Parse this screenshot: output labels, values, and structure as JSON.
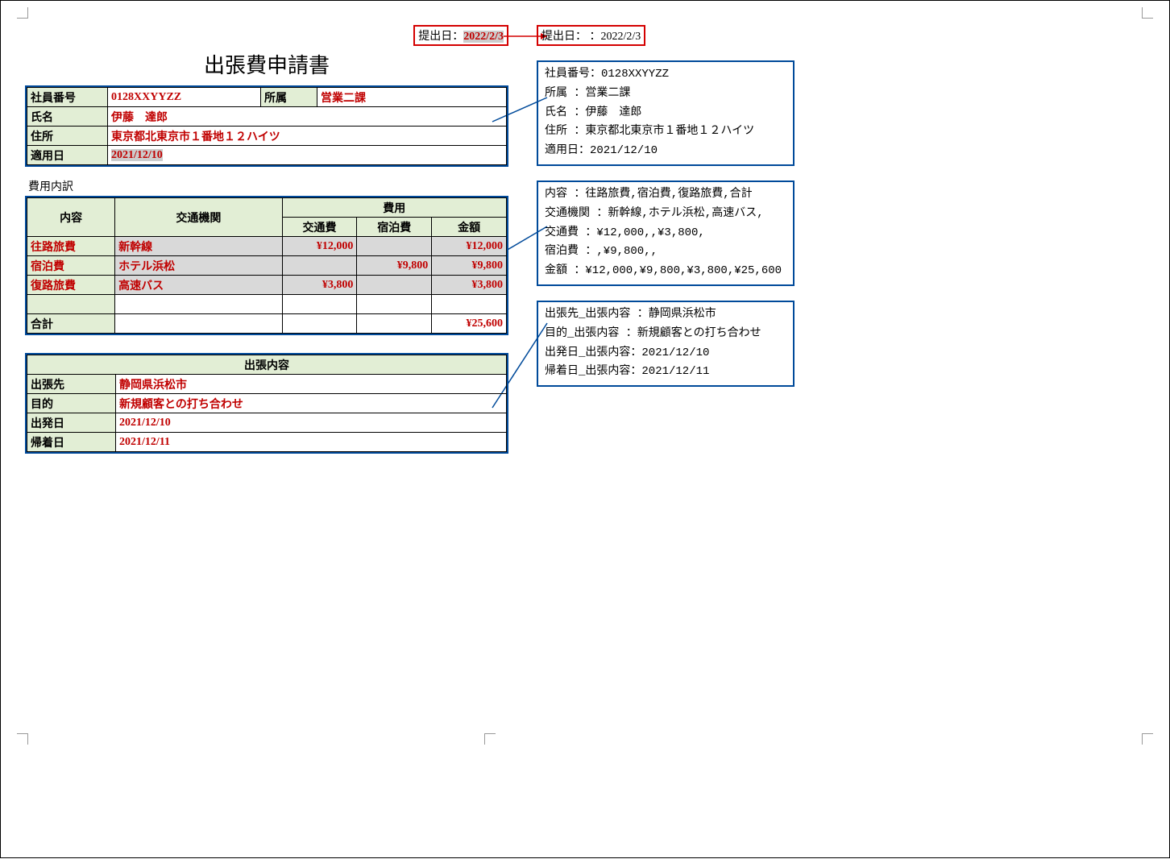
{
  "submit": {
    "label": "提出日：",
    "date": "2022/2/3"
  },
  "submit2": {
    "label": "提出日： ：",
    "date": "2022/2/3"
  },
  "title": "出張費申請書",
  "employee": {
    "id_label": "社員番号",
    "id": "0128XXYYZZ",
    "dept_label": "所属",
    "dept": "営業二課",
    "name_label": "氏名",
    "name": "伊藤　達郎",
    "addr_label": "住所",
    "addr": "東京都北東京市１番地１２ハイツ",
    "apply_label": "適用日",
    "apply": "2021/12/10"
  },
  "expense": {
    "section_label": "費用内訳",
    "headers": {
      "content": "内容",
      "transport": "交通機関",
      "cost": "費用",
      "trans_cost": "交通費",
      "lodge_cost": "宿泊費",
      "amount": "金額"
    },
    "rows": [
      {
        "content": "往路旅費",
        "transport": "新幹線",
        "trans": "¥12,000",
        "lodge": "",
        "amount": "¥12,000",
        "shade": true
      },
      {
        "content": "宿泊費",
        "transport": "ホテル浜松",
        "trans": "",
        "lodge": "¥9,800",
        "amount": "¥9,800",
        "shade": true
      },
      {
        "content": "復路旅費",
        "transport": "高速バス",
        "trans": "¥3,800",
        "lodge": "",
        "amount": "¥3,800",
        "shade": true
      },
      {
        "content": "",
        "transport": "",
        "trans": "",
        "lodge": "",
        "amount": "",
        "shade": false
      }
    ],
    "total_label": "合計",
    "total": "¥25,600"
  },
  "trip": {
    "header": "出張内容",
    "dest_label": "出張先",
    "dest": "静岡県浜松市",
    "purpose_label": "目的",
    "purpose": "新規顧客との打ち合わせ",
    "depart_label": "出発日",
    "depart": "2021/12/10",
    "return_label": "帰着日",
    "return": "2021/12/11"
  },
  "anno1": {
    "l1a": "社員番号：",
    "l1b": "0128XXYYZZ",
    "l2": "所属 ：営業二課",
    "l3": "氏名 ：伊藤　達郎",
    "l4": "住所 ：東京都北東京市１番地１２ハイツ",
    "l5": "適用日：2021/12/10"
  },
  "anno2": {
    "l1": "内容 ：往路旅費,宿泊費,復路旅費,合計",
    "l2": "交通機関 ：新幹線,ホテル浜松,高速バス,",
    "l3": "交通費 ：¥12,000,,¥3,800,",
    "l4": "宿泊費 ：,¥9,800,,",
    "l5": "金額 ：¥12,000,¥9,800,¥3,800,¥25,600"
  },
  "anno3": {
    "l1": "出張先_出張内容 ：静岡県浜松市",
    "l2": "目的_出張内容 ：新規顧客との打ち合わせ",
    "l3": "出発日_出張内容：2021/12/10",
    "l4": "帰着日_出張内容：2021/12/11"
  }
}
